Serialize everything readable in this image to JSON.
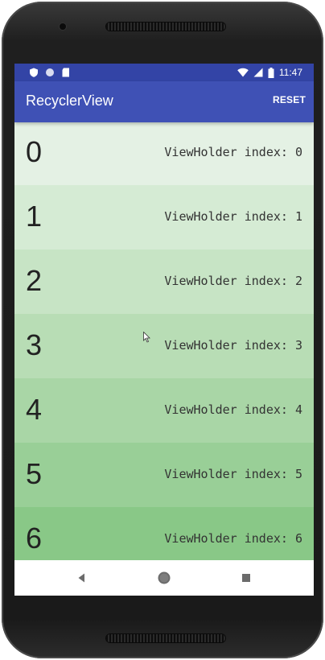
{
  "status_bar": {
    "time": "11:47",
    "left_icons": [
      "shield-icon",
      "circle-icon",
      "sd-card-icon"
    ],
    "right_icons": [
      "wifi-icon",
      "signal-icon",
      "battery-icon"
    ],
    "background": "#3344a6"
  },
  "app_bar": {
    "title": "RecyclerView",
    "action_label": "RESET",
    "background": "#3f51b5"
  },
  "list": {
    "items": [
      {
        "number": "0",
        "label": "ViewHolder index: 0",
        "color": "#e4f1e4"
      },
      {
        "number": "1",
        "label": "ViewHolder index: 1",
        "color": "#d5ebd4"
      },
      {
        "number": "2",
        "label": "ViewHolder index: 2",
        "color": "#c7e4c5"
      },
      {
        "number": "3",
        "label": "ViewHolder index: 3",
        "color": "#b8ddb5"
      },
      {
        "number": "4",
        "label": "ViewHolder index: 4",
        "color": "#a9d6a6"
      },
      {
        "number": "5",
        "label": "ViewHolder index: 5",
        "color": "#99cf97"
      },
      {
        "number": "6",
        "label": "ViewHolder index: 6",
        "color": "#89c887"
      }
    ]
  },
  "nav_bar": {
    "buttons": [
      "back-icon",
      "home-icon",
      "recents-icon"
    ]
  }
}
